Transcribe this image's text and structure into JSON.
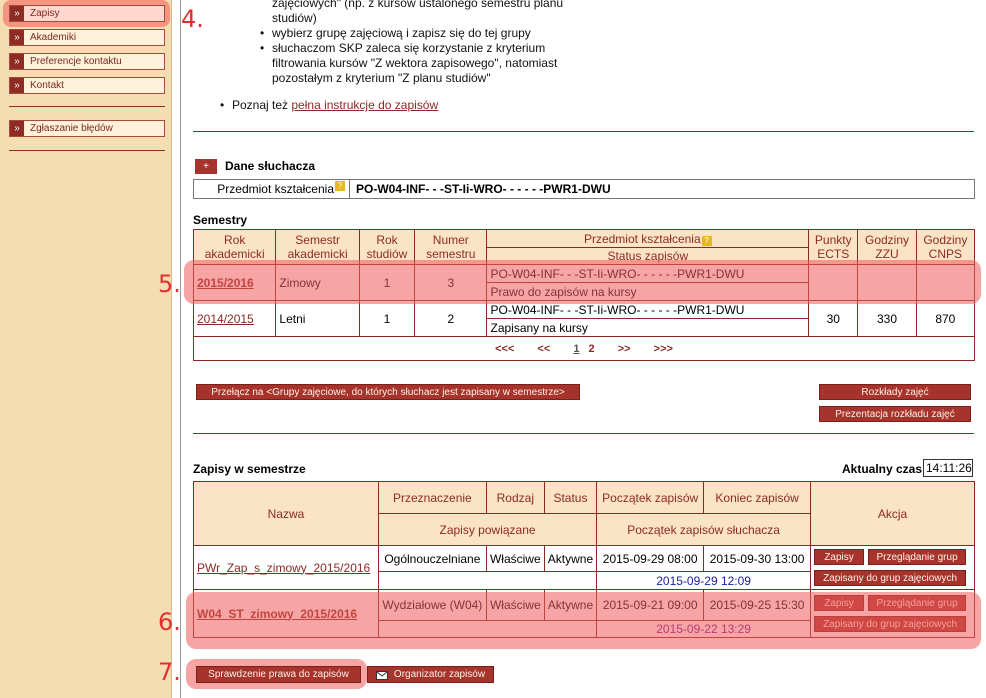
{
  "sidebar": {
    "items": [
      {
        "label": "Zapisy"
      },
      {
        "label": "Akademiki"
      },
      {
        "label": "Preferencje kontaktu"
      },
      {
        "label": "Kontakt"
      },
      {
        "label": "Zgłaszanie błędów"
      }
    ]
  },
  "steps": {
    "s4": "4.",
    "s5": "5.",
    "s6": "6.",
    "s7": "7."
  },
  "intro": {
    "line0a": "zajęciowych\" (np. z kursów ustalonego semestru planu",
    "line0b": "studiów)",
    "b1": "wybierz grupę zajęciową i zapisz się do tej grupy",
    "b2a": "słuchaczom SKP zaleca się korzystanie z kryterium",
    "b2b": "filtrowania kursów \"Z wektora zapisowego\", natomiast",
    "b2c": "pozostałym z kryterium \"Z planu studiów\"",
    "poznaj_prefix": "Poznaj też ",
    "poznaj_link": "pełna instrukcje do zapisów"
  },
  "student": {
    "toggle": "+",
    "title": "Dane słuchacza",
    "field_label": "Przedmiot kształcenia",
    "field_value": "PO-W04-INF- - -ST-Ii-WRO- - - - - -PWR1-DWU"
  },
  "semesters": {
    "title": "Semestry",
    "headers": {
      "rok": "Rok akademicki",
      "semestr": "Semestr akademicki",
      "rok_st": "Rok studiów",
      "numer": "Numer semestru",
      "przedmiot": "Przedmiot kształcenia",
      "status": "Status zapisów",
      "ects": "Punkty ECTS",
      "zzu": "Godziny ZZU",
      "cnps": "Godziny CNPS"
    },
    "rows": [
      {
        "rok": "2015/2016",
        "sem": "Zimowy",
        "rok_st": "1",
        "numer": "3",
        "przedmiot": "PO-W04-INF- - -ST-Ii-WRO- - - - - -PWR1-DWU",
        "status": "Prawo do zapisów na kursy",
        "ects": "",
        "zzu": "",
        "cnps": ""
      },
      {
        "rok": "2014/2015",
        "sem": "Letni",
        "rok_st": "1",
        "numer": "2",
        "przedmiot": "PO-W04-INF- - -ST-Ii-WRO- - - - - -PWR1-DWU",
        "status": "Zapisany na kursy",
        "ects": "30",
        "zzu": "330",
        "cnps": "870"
      }
    ],
    "pager": {
      "first": "<<<",
      "prev": "<<",
      "p1": "1",
      "p2": "2",
      "next": ">>",
      "last": ">>>"
    }
  },
  "buttons": {
    "przelacz": "Przełącz na <Grupy zajęciowe, do których słuchacz jest zapisany w semestrze>",
    "rozklady": "Rozkłady zajęć",
    "prezentacja": "Prezentacja rozkładu zajęć",
    "sprawdzenie": "Sprawdzenie prawa do zapisów",
    "organizator": "Organizator zapisów"
  },
  "zapisy": {
    "title": "Zapisy w semestrze",
    "time_label": "Aktualny czas",
    "time_value": "14:11:26",
    "headers": {
      "nazwa": "Nazwa",
      "przeznaczenie": "Przeznaczenie",
      "rodzaj": "Rodzaj",
      "status": "Status",
      "poczatek": "Początek zapisów",
      "koniec": "Koniec zapisów",
      "akcja": "Akcja",
      "powiazane": "Zapisy powiązane",
      "poczatek_sl": "Początek zapisów słuchacza"
    },
    "rows": [
      {
        "nazwa": "PWr_Zap_s_zimowy_2015/2016",
        "przeznaczenie": "Ogólnouczelniane",
        "rodzaj": "Właściwe",
        "status": "Aktywne",
        "poczatek": "2015-09-29 08:00",
        "koniec": "2015-09-30 13:00",
        "start_sl": "2015-09-29 12:09",
        "a1": "Zapisy",
        "a2": "Przeglądanie grup",
        "a3": "Zapisany do grup zajęciowych"
      },
      {
        "nazwa": "W04_ST_zimowy_2015/2016",
        "przeznaczenie": "Wydziałowe (W04)",
        "rodzaj": "Właściwe",
        "status": "Aktywne",
        "poczatek": "2015-09-21 09:00",
        "koniec": "2015-09-25 15:30",
        "start_sl": "2015-09-22 13:29",
        "a1": "Zapisy",
        "a2": "Przeglądanie grup",
        "a3": "Zapisany do grup zajęciowych"
      }
    ]
  }
}
